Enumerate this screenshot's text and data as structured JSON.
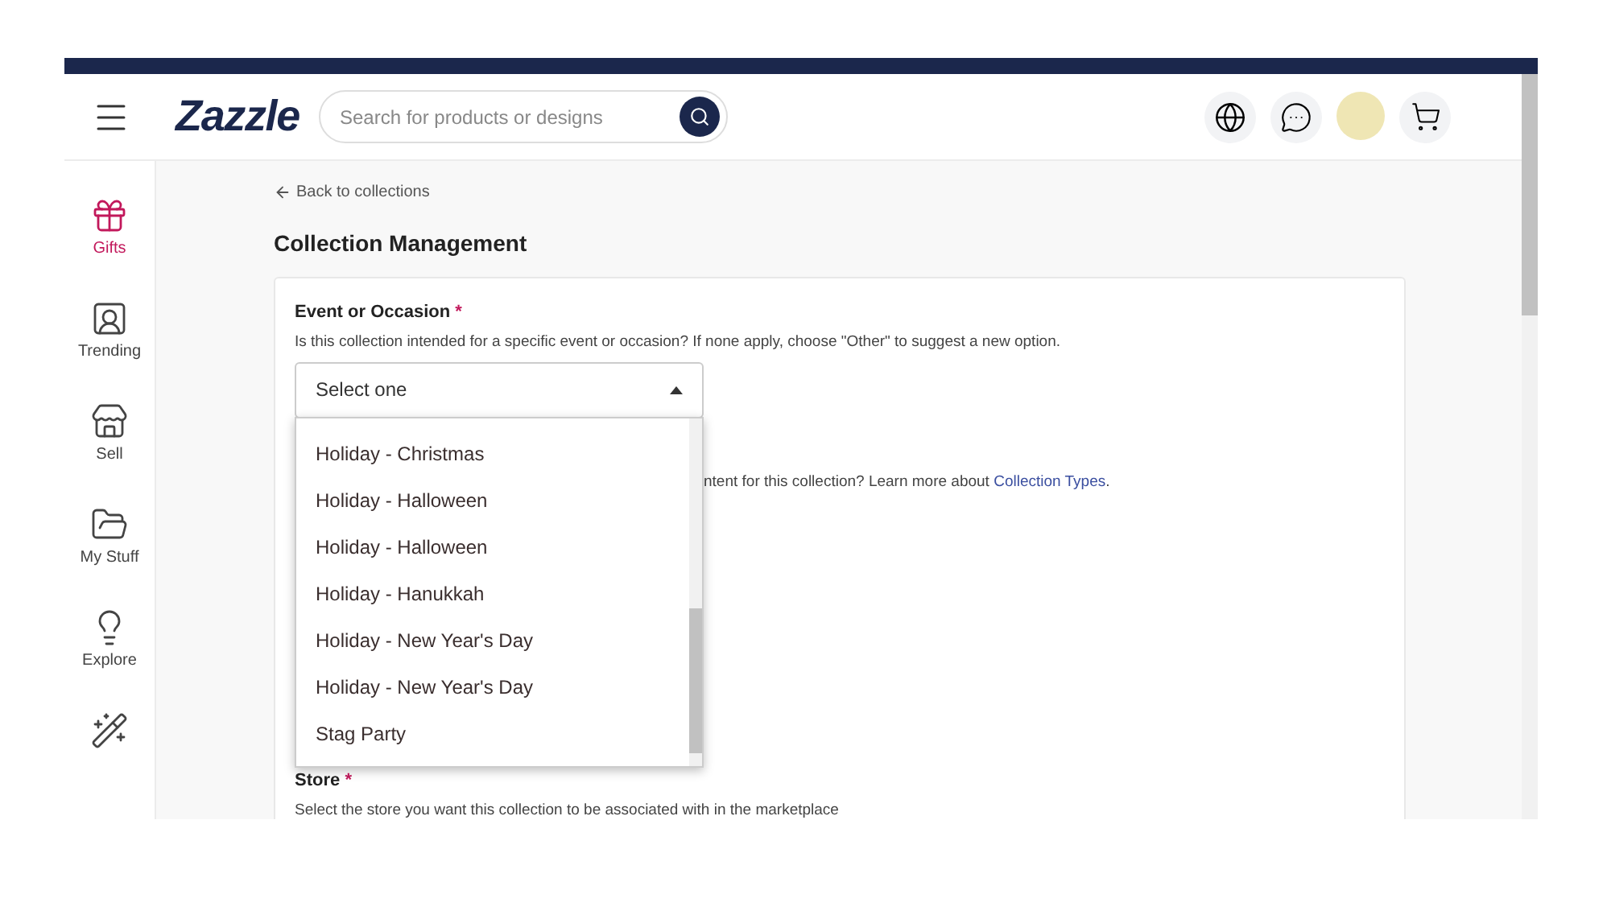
{
  "header": {
    "logo": "Zazzle",
    "search": {
      "placeholder": "Search for products or designs"
    }
  },
  "sidebar": {
    "items": [
      {
        "kind": "gift",
        "label": "Gifts",
        "selected": true
      },
      {
        "kind": "trending",
        "label": "Trending",
        "selected": false
      },
      {
        "kind": "store",
        "label": "Sell",
        "selected": false
      },
      {
        "kind": "folder",
        "label": "My Stuff",
        "selected": false
      },
      {
        "kind": "bulb",
        "label": "Explore",
        "selected": false
      },
      {
        "kind": "wand",
        "selected": false
      }
    ]
  },
  "back_link": "Back to collections",
  "title": "Collection Management",
  "event_field": {
    "label": "Event or Occasion",
    "required_mark": "*",
    "help": "Is this collection intended for a specific event or occasion? If none apply, choose \"Other\" to suggest a new option.",
    "select": {
      "value": "Select one",
      "expanded": true,
      "options": [
        "Holiday - Christmas",
        "Holiday - Halloween",
        "Holiday - Halloween",
        "Holiday - Hanukkah",
        "Holiday - New Year's Day",
        "Holiday - New Year's Day",
        "Stag Party"
      ]
    }
  },
  "type_field": {
    "help": "ntent for this collection? Learn more about ",
    "link": "Collection Types",
    "trailing": "."
  },
  "store_field": {
    "label": "Store",
    "required_mark": "*",
    "help": "Select the store you want this collection to be associated with in the marketplace"
  }
}
